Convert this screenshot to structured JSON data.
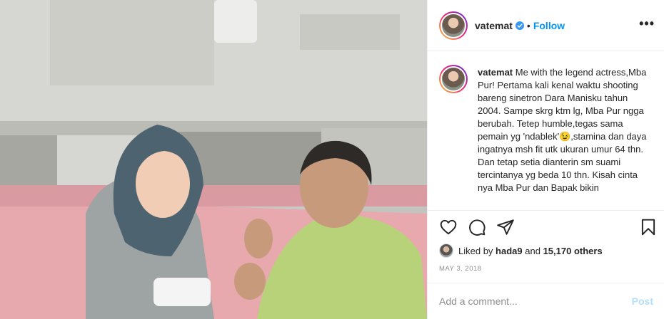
{
  "colors": {
    "accent": "#0095f6",
    "text": "#262626",
    "muted": "#8e8e8e",
    "post_disabled": "#b2dffc",
    "border": "#efefef"
  },
  "header": {
    "username": "vatemat",
    "verified_icon": "verified-badge-icon",
    "separator": "•",
    "follow_label": "Follow",
    "more_label": "•••"
  },
  "caption": {
    "username": "vatemat",
    "text": "Me with the legend actress,Mba Pur! Pertama kali kenal waktu shooting bareng sinetron Dara Manisku tahun 2004. Sampe skrg ktm lg, Mba Pur ngga berubah. Tetep humble,tegas sama pemain yg 'ndablek'😉,stamina dan daya ingatnya msh fit utk ukuran umur 64 thn. Dan tetap setia dianterin sm suami tercintanya yg beda 10 thn. Kisah cinta nya Mba Pur dan Bapak bikin"
  },
  "actions": {
    "like_icon": "heart-icon",
    "comment_icon": "comment-icon",
    "share_icon": "share-icon",
    "save_icon": "bookmark-icon"
  },
  "likes": {
    "prefix": "Liked by",
    "user": "hada9",
    "middle": "and",
    "others": "15,170 others"
  },
  "date": "MAY 3, 2018",
  "comment": {
    "placeholder": "Add a comment...",
    "value": "",
    "post_label": "Post"
  }
}
